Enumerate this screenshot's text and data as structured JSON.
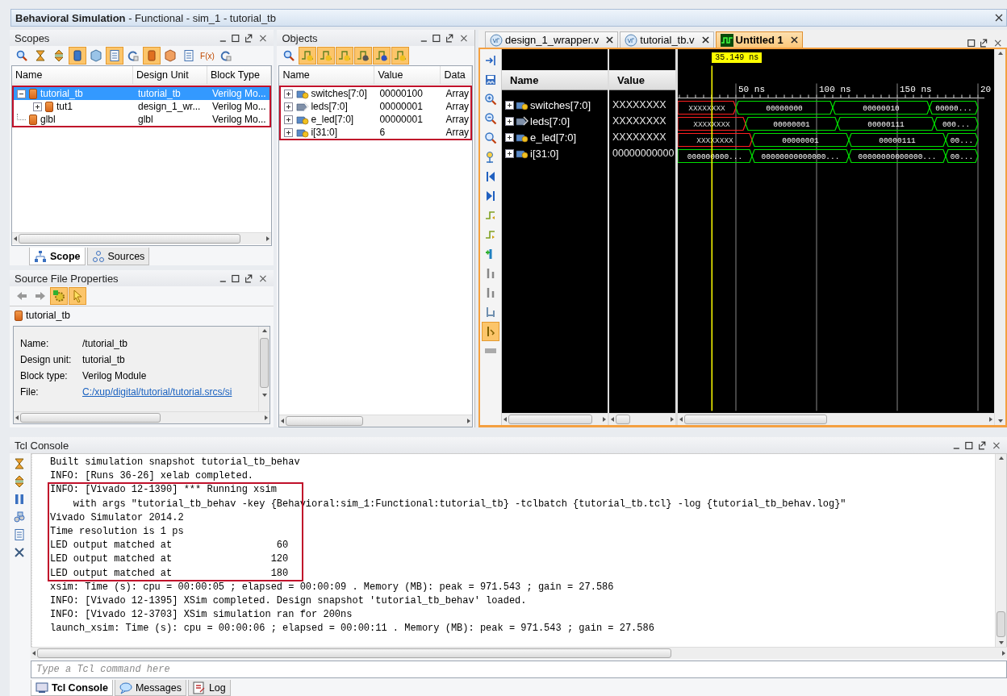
{
  "title_bar": {
    "title": "**Behavioral Simulation** - Functional - sim_1 - tutorial_tb"
  },
  "scopes": {
    "title": "Scopes",
    "toolbar": [
      {
        "kind": "search",
        "on": false
      },
      {
        "kind": "collapse",
        "on": false
      },
      {
        "kind": "expand",
        "on": false
      },
      {
        "kind": "module",
        "on": true
      },
      {
        "kind": "cube",
        "on": false
      },
      {
        "kind": "listing",
        "on": true
      },
      {
        "kind": "refresh",
        "on": false
      },
      {
        "kind": "block",
        "on": true
      },
      {
        "kind": "package",
        "on": false
      },
      {
        "kind": "listing",
        "on": false
      },
      {
        "kind": "function",
        "label": "F(x)",
        "on": false
      },
      {
        "kind": "refresh",
        "on": false
      }
    ],
    "columns": [
      "Name",
      "Design Unit",
      "Block Type"
    ],
    "highlighted": true,
    "rows": [
      {
        "name": "tutorial_tb",
        "design_unit": "tutorial_tb",
        "block_type": "Verilog Mo...",
        "selected": true,
        "expanded": true,
        "children": [
          {
            "name": "tut1",
            "design_unit": "design_1_wr...",
            "block_type": "Verilog Mo...",
            "selected": false,
            "expanded": false
          }
        ]
      },
      {
        "name": "glbl",
        "design_unit": "glbl",
        "block_type": "Verilog Mo...",
        "selected": false
      }
    ],
    "tabs": [
      {
        "label": "Scope",
        "selected": true,
        "kind": "hierarchy"
      },
      {
        "label": "Sources",
        "selected": false,
        "kind": "sources"
      }
    ]
  },
  "source_properties": {
    "title": "Source File Properties",
    "toolbar": [
      {
        "kind": "back",
        "on": false
      },
      {
        "kind": "forward",
        "on": false
      },
      {
        "kind": "gear",
        "on": true
      },
      {
        "kind": "pointer",
        "on": true
      }
    ],
    "object": "tutorial_tb",
    "fields": [
      {
        "label": "Name:",
        "value": "/tutorial_tb",
        "kind": "text"
      },
      {
        "label": "Design unit:",
        "value": "tutorial_tb",
        "kind": "text"
      },
      {
        "label": "Block type:",
        "value": "Verilog Module",
        "kind": "text"
      },
      {
        "label": "File:",
        "value": "C:/xup/digital/tutorial/tutorial.srcs/si",
        "kind": "link"
      }
    ]
  },
  "objects": {
    "title": "Objects",
    "toolbar": [
      {
        "kind": "search",
        "on": false
      },
      {
        "kind": "signal",
        "on": true
      },
      {
        "kind": "signal",
        "on": true
      },
      {
        "kind": "signal",
        "on": true
      },
      {
        "kind": "probe",
        "on": true
      },
      {
        "kind": "constant",
        "on": true
      },
      {
        "kind": "variable",
        "on": true
      }
    ],
    "columns": [
      "Name",
      "Value",
      "Data"
    ],
    "highlighted": true,
    "rows": [
      {
        "name": "switches[7:0]",
        "value": "00000100",
        "data_type": "Array",
        "kind": "variable"
      },
      {
        "name": "leds[7:0]",
        "value": "00000001",
        "data_type": "Array",
        "kind": "output"
      },
      {
        "name": "e_led[7:0]",
        "value": "00000001",
        "data_type": "Array",
        "kind": "variable"
      },
      {
        "name": "i[31:0]",
        "value": "6",
        "data_type": "Array",
        "kind": "variable"
      }
    ]
  },
  "wave": {
    "tabs": [
      {
        "label": "design_1_wrapper.v",
        "selected": false,
        "kind": "verilog"
      },
      {
        "label": "tutorial_tb.v",
        "selected": false,
        "kind": "verilog"
      },
      {
        "label": "Untitled 1",
        "selected": true,
        "kind": "waveform"
      }
    ],
    "toolbar": [
      {
        "kind": "to-line",
        "on": false
      },
      {
        "kind": "save",
        "on": false
      },
      {
        "kind": "zoom-in",
        "on": false
      },
      {
        "kind": "zoom-out",
        "on": false
      },
      {
        "kind": "zoom-fit",
        "on": false
      },
      {
        "kind": "cursor",
        "on": false
      },
      {
        "kind": "first",
        "on": false
      },
      {
        "kind": "last",
        "on": false
      },
      {
        "kind": "prev-edge",
        "on": false
      },
      {
        "kind": "next-edge",
        "on": false
      },
      {
        "kind": "add-marker",
        "on": false
      },
      {
        "kind": "prev-marker",
        "on": false
      },
      {
        "kind": "next-marker",
        "on": false
      },
      {
        "kind": "swap",
        "on": false
      },
      {
        "kind": "snap",
        "on": true
      },
      {
        "kind": "blank",
        "on": false
      }
    ],
    "columns": [
      "Name",
      "Value"
    ],
    "cursor": "35.149 ns",
    "ruler": [
      "50 ns",
      "100 ns",
      "150 ns",
      "20"
    ],
    "signals": [
      {
        "name": "switches[7:0]",
        "value": "XXXXXXXX",
        "kind": "variable",
        "segments": [
          {
            "label": "XXXXXXXX",
            "kind": "unknown"
          },
          {
            "label": "00000000",
            "kind": "value"
          },
          {
            "label": "00000010",
            "kind": "value"
          },
          {
            "label": "00000...",
            "kind": "value"
          }
        ]
      },
      {
        "name": "leds[7:0]",
        "value": "XXXXXXXX",
        "kind": "output",
        "segments": [
          {
            "label": "XXXXXXXX",
            "kind": "unknown"
          },
          {
            "label": "00000001",
            "kind": "value"
          },
          {
            "label": "00000111",
            "kind": "value"
          },
          {
            "label": "000...",
            "kind": "value"
          }
        ]
      },
      {
        "name": "e_led[7:0]",
        "value": "XXXXXXXX",
        "kind": "variable",
        "segments": [
          {
            "label": "XXXXXXXX",
            "kind": "unknown"
          },
          {
            "label": "00000001",
            "kind": "value"
          },
          {
            "label": "00000111",
            "kind": "value"
          },
          {
            "label": "00...",
            "kind": "value"
          }
        ]
      },
      {
        "name": "i[31:0]",
        "value": "00000000000",
        "kind": "variable",
        "segments": [
          {
            "label": "000000000...",
            "kind": "value"
          },
          {
            "label": "00000000000000...",
            "kind": "value"
          },
          {
            "label": "00000000000000...",
            "kind": "value"
          },
          {
            "label": "00...",
            "kind": "value"
          }
        ]
      }
    ]
  },
  "console": {
    "title": "Tcl Console",
    "toolbar": [
      {
        "kind": "collapse",
        "on": false
      },
      {
        "kind": "expand",
        "on": false
      },
      {
        "kind": "pause",
        "on": false
      },
      {
        "kind": "binoculars",
        "on": false
      },
      {
        "kind": "copy",
        "on": false
      },
      {
        "kind": "clear",
        "on": false
      }
    ],
    "blocks": [
      {
        "highlighted": false,
        "lines": [
          "Built simulation snapshot tutorial_tb_behav",
          "INFO: [Runs 36-26] xelab completed."
        ]
      },
      {
        "highlighted": true,
        "lines": [
          "INFO: [Vivado 12-1390] *** Running xsim",
          "    with args \"tutorial_tb_behav -key {Behavioral:sim_1:Functional:tutorial_tb} -tclbatch {tutorial_tb.tcl} -log {tutorial_tb_behav.log}\"",
          "Vivado Simulator 2014.2",
          "Time resolution is 1 ps",
          "LED output matched at                  60",
          "LED output matched at                 120",
          "LED output matched at                 180"
        ]
      },
      {
        "highlighted": false,
        "lines": [
          "xsim: Time (s): cpu = 00:00:05 ; elapsed = 00:00:09 . Memory (MB): peak = 971.543 ; gain = 27.586",
          "INFO: [Vivado 12-1395] XSim completed. Design snapshot 'tutorial_tb_behav' loaded.",
          "INFO: [Vivado 12-3703] XSim simulation ran for 200ns",
          "launch_xsim: Time (s): cpu = 00:00:06 ; elapsed = 00:00:11 . Memory (MB): peak = 971.543 ; gain = 27.586"
        ]
      }
    ],
    "placeholder": "Type a Tcl command here",
    "tabs": [
      {
        "label": "Tcl Console",
        "selected": true,
        "kind": "console"
      },
      {
        "label": "Messages",
        "selected": false,
        "kind": "messages"
      },
      {
        "label": "Log",
        "selected": false,
        "kind": "log"
      }
    ]
  }
}
